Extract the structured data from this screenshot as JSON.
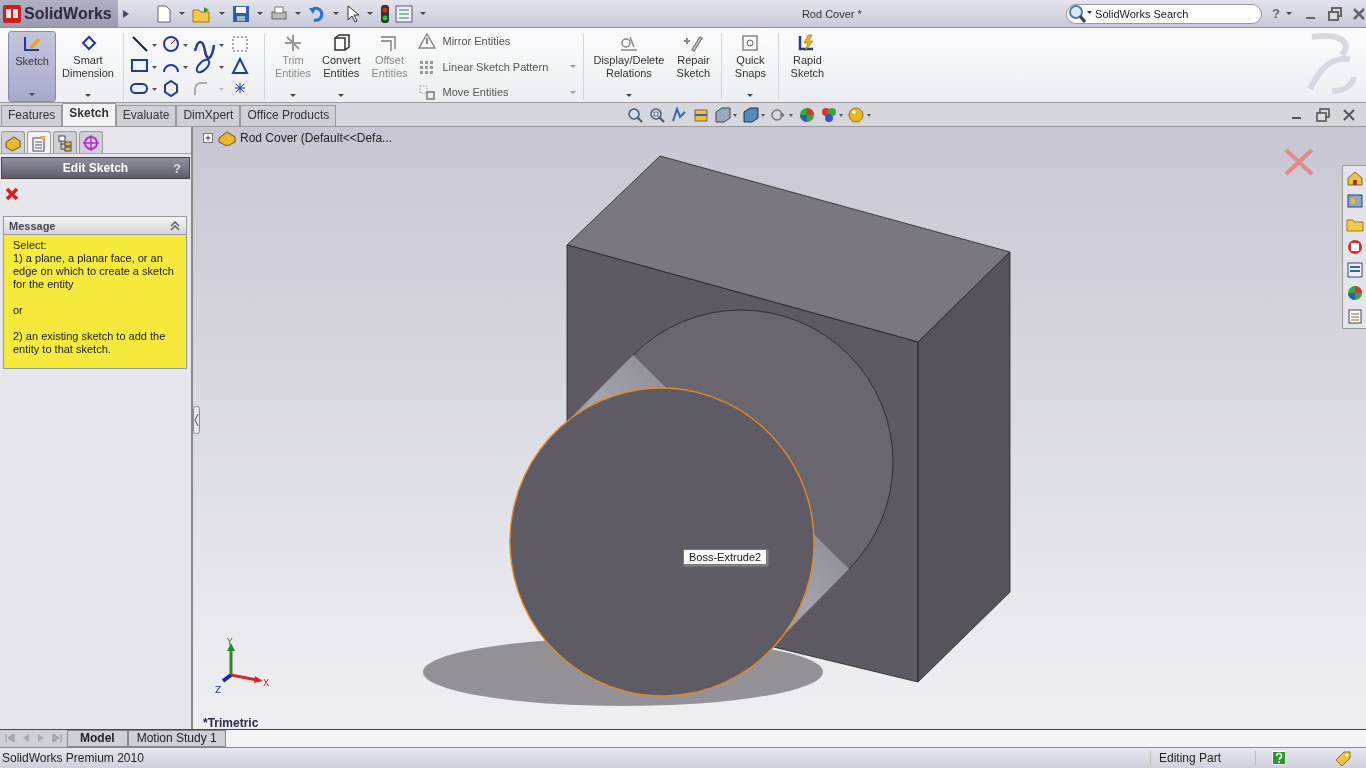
{
  "app": {
    "logo": "SolidWorks",
    "title": "Rod Cover *",
    "search": {
      "placeholder": "SolidWorks Search"
    },
    "help": "?"
  },
  "ribbon": {
    "sketch_buttons": [
      {
        "label": "Sketch",
        "kind": "sketch",
        "selected": true,
        "disabled": false,
        "menu": true
      },
      {
        "label": "Smart Dimension",
        "kind": "dimension",
        "selected": false,
        "disabled": false,
        "menu": true
      }
    ],
    "entity_buttons": [
      {
        "label": "Trim Entities",
        "kind": "trim",
        "selected": false,
        "disabled": true,
        "menu": true
      },
      {
        "label": "Convert Entities",
        "kind": "convert",
        "selected": false,
        "disabled": false,
        "menu": true
      },
      {
        "label": "Offset Entities",
        "kind": "offset",
        "selected": false,
        "disabled": true,
        "menu": false
      }
    ],
    "entity_tools": [
      {
        "label": "Mirror Entities",
        "kind": "mirror",
        "menu": false
      },
      {
        "label": "Linear Sketch Pattern",
        "kind": "pattern",
        "menu": true
      },
      {
        "label": "Move Entities",
        "kind": "move",
        "menu": true
      }
    ],
    "relation_buttons": [
      {
        "label": "Display/Delete Relations",
        "kind": "relations",
        "selected": false,
        "disabled": false,
        "menu": true
      },
      {
        "label": "Repair Sketch",
        "kind": "repair",
        "selected": false,
        "disabled": false,
        "menu": false
      },
      {
        "label": "Quick Snaps",
        "kind": "snaps",
        "selected": false,
        "disabled": false,
        "menu": true
      },
      {
        "label": "Rapid Sketch",
        "kind": "rapid",
        "selected": false,
        "disabled": false,
        "menu": false
      }
    ]
  },
  "tabs": [
    {
      "label": "Features",
      "selected": false
    },
    {
      "label": "Sketch",
      "selected": true
    },
    {
      "label": "Evaluate",
      "selected": false
    },
    {
      "label": "DimXpert",
      "selected": false
    },
    {
      "label": "Office Products",
      "selected": false
    }
  ],
  "panel": {
    "tabs": [
      {
        "kind": "tree",
        "selected": false
      },
      {
        "kind": "property",
        "selected": true
      },
      {
        "kind": "config",
        "selected": false
      },
      {
        "kind": "dim",
        "selected": false
      }
    ],
    "header": "Edit Sketch",
    "help": "?",
    "message": {
      "title": "Message",
      "text": "Select:\n1) a plane, a planar face, or an edge on which to create a sketch for the entity\n\nor\n\n2) an existing sketch to add the entity to that sketch."
    }
  },
  "viewport": {
    "tree_item": "Rod Cover  (Default<<Defa...",
    "tooltip": "Boss-Extrude2",
    "triad": {
      "y": "Y",
      "x": "X",
      "z": "Z"
    },
    "view_name": "*Trimetric"
  },
  "bottom_tabs": [
    {
      "label": "Model",
      "selected": true
    },
    {
      "label": "Motion Study 1",
      "selected": false
    }
  ],
  "status_bar": {
    "product": "SolidWorks Premium 2010",
    "mode": "Editing Part"
  }
}
